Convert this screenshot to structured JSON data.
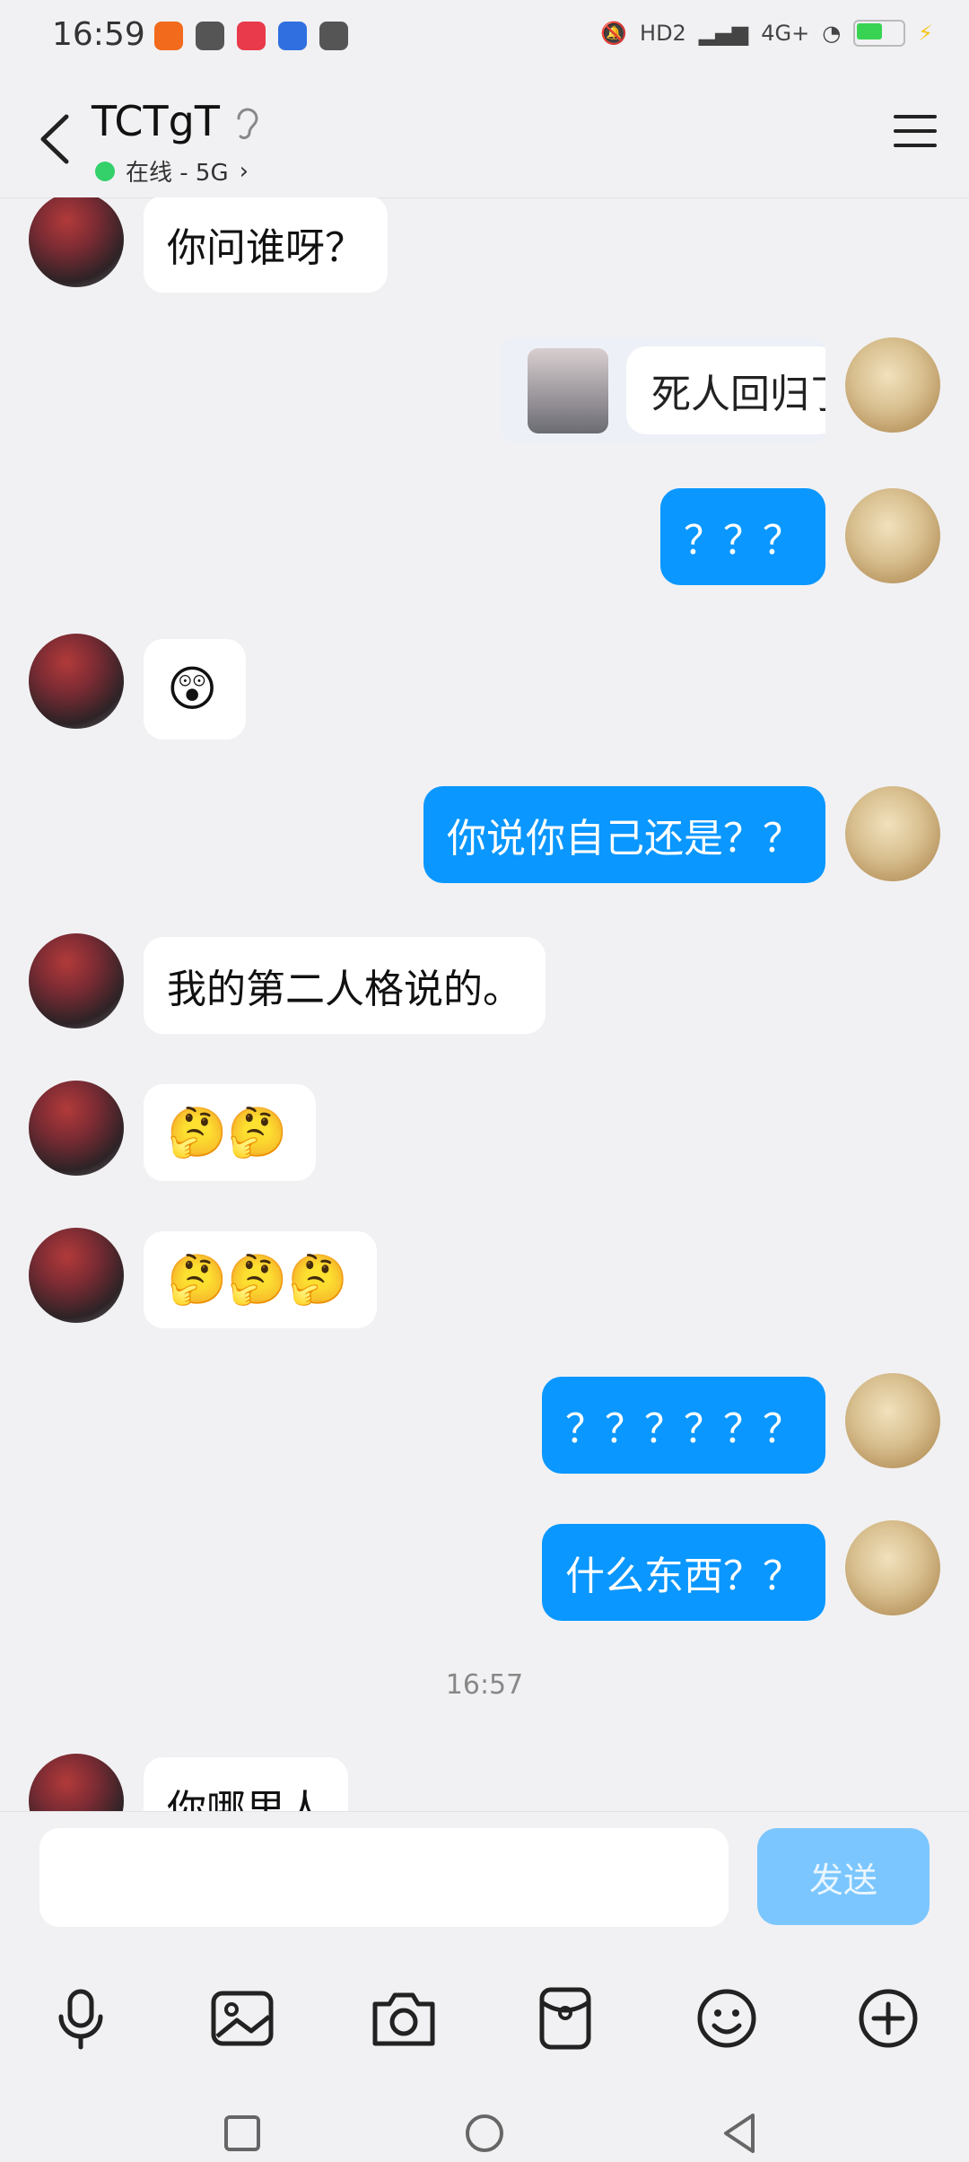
{
  "status_bar": {
    "time": "16:59",
    "network": "4G+",
    "hd_label": "HD2",
    "app_icons": [
      "orange-app-icon",
      "link-app-icon",
      "red-app-icon",
      "baidu-app-icon",
      "card-app-icon"
    ],
    "battery_color": "#39d353"
  },
  "header": {
    "contact_name": "TCTgT",
    "online_status": "在线 - 5G",
    "online_color": "#34d06a"
  },
  "messages": [
    {
      "side": "left",
      "kind": "text",
      "text": "你问谁呀？"
    },
    {
      "side": "right",
      "kind": "sticker",
      "text": "死人回归了"
    },
    {
      "side": "right",
      "kind": "text",
      "text": "？？？"
    },
    {
      "side": "left",
      "kind": "emoji",
      "text": "😲"
    },
    {
      "side": "right",
      "kind": "text",
      "text": "你说你自己还是？？"
    },
    {
      "side": "left",
      "kind": "text",
      "text": "我的第二人格说的。"
    },
    {
      "side": "left",
      "kind": "emoji",
      "text": "🤔🤔"
    },
    {
      "side": "left",
      "kind": "emoji",
      "text": "🤔🤔🤔"
    },
    {
      "side": "right",
      "kind": "text",
      "text": "？？？？？？"
    },
    {
      "side": "right",
      "kind": "text",
      "text": "什么东西？？"
    },
    {
      "kind": "timestamp",
      "text": "16:57"
    },
    {
      "side": "left",
      "kind": "text",
      "text": "你哪里人"
    }
  ],
  "input": {
    "placeholder": "",
    "send_label": "发送"
  },
  "toolbar": {
    "icons": [
      "microphone-icon",
      "image-icon",
      "camera-icon",
      "red-packet-icon",
      "emoji-icon",
      "plus-icon"
    ]
  },
  "colors": {
    "bubble_blue": "#0a97ff",
    "send_button": "#7bc6ff",
    "background": "#f1f1f3"
  }
}
